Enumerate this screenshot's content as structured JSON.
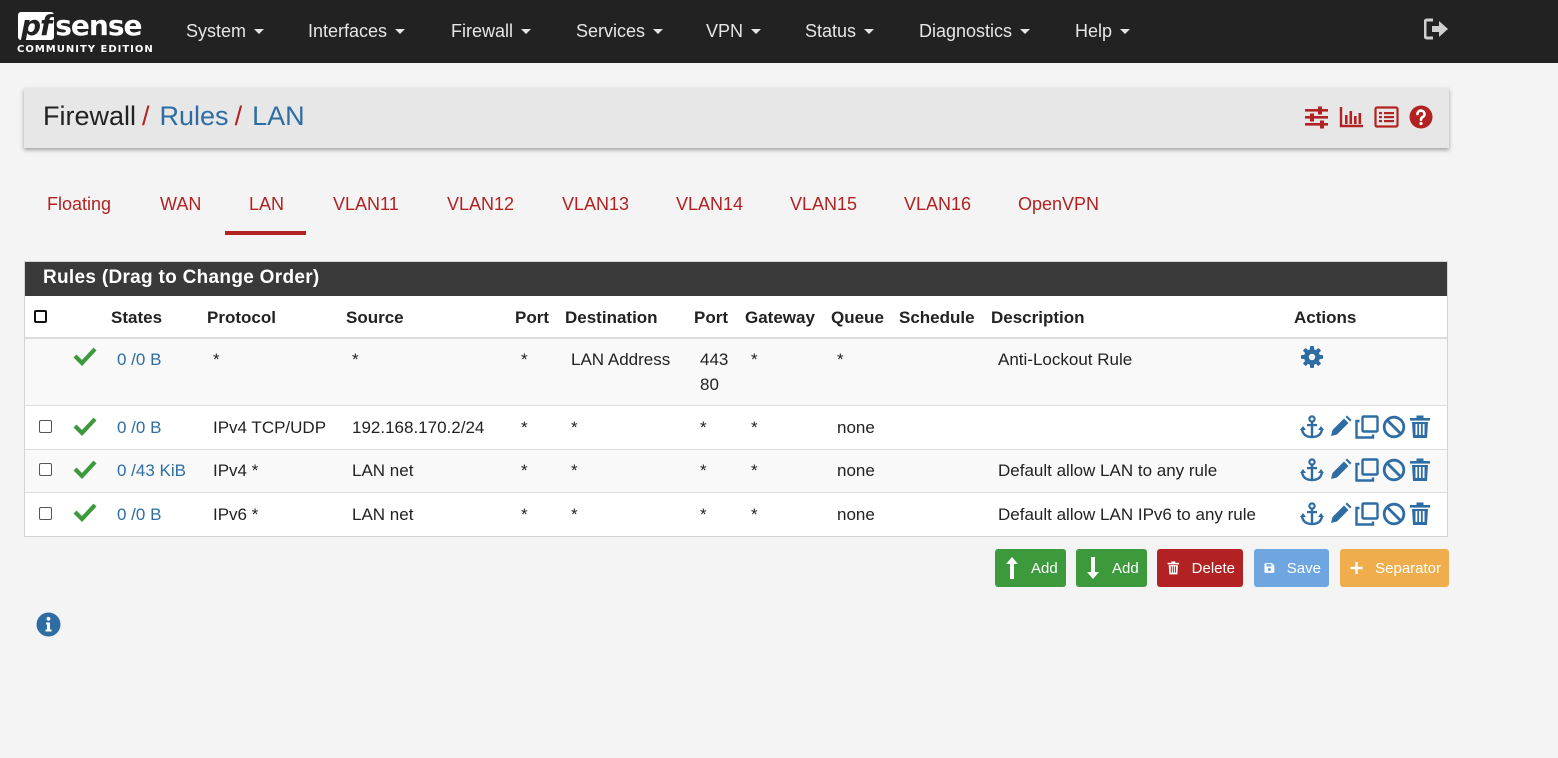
{
  "brand": {
    "logo_main_left": "pf",
    "logo_main_right": "sense",
    "logo_sub": "COMMUNITY EDITION"
  },
  "nav": {
    "menus": [
      "System",
      "Interfaces",
      "Firewall",
      "Services",
      "VPN",
      "Status",
      "Diagnostics",
      "Help"
    ],
    "logout_icon": "sign-out-icon"
  },
  "breadcrumb": {
    "root": "Firewall",
    "level2": "Rules",
    "level3": "LAN",
    "separator": "/"
  },
  "breadcrumb_icons": [
    "sliders-icon",
    "bar-chart-icon",
    "list-icon",
    "help-icon"
  ],
  "tabs": [
    "Floating",
    "WAN",
    "LAN",
    "VLAN11",
    "VLAN12",
    "VLAN13",
    "VLAN14",
    "VLAN15",
    "VLAN16",
    "OpenVPN"
  ],
  "active_tab": "LAN",
  "panel": {
    "title": "Rules (Drag to Change Order)",
    "columns": [
      "States",
      "Protocol",
      "Source",
      "Port",
      "Destination",
      "Port",
      "Gateway",
      "Queue",
      "Schedule",
      "Description",
      "Actions"
    ]
  },
  "rules": [
    {
      "states": "0 /0 B",
      "protocol": "*",
      "source": "*",
      "src_port": "*",
      "destination": "LAN Address",
      "dst_port": "443",
      "dst_port2": "80",
      "gateway": "*",
      "queue": "*",
      "schedule": "",
      "description": "Anti-Lockout Rule"
    },
    {
      "states": "0 /0 B",
      "protocol": "IPv4 TCP/UDP",
      "source": "192.168.170.2/24",
      "src_port": "*",
      "destination": "*",
      "dst_port": "*",
      "gateway": "*",
      "queue": "none",
      "schedule": "",
      "description": ""
    },
    {
      "states": "0 /43 KiB",
      "protocol": "IPv4 *",
      "source": "LAN net",
      "src_port": "*",
      "destination": "*",
      "dst_port": "*",
      "gateway": "*",
      "queue": "none",
      "schedule": "",
      "description": "Default allow LAN to any rule"
    },
    {
      "states": "0 /0 B",
      "protocol": "IPv6 *",
      "source": "LAN net",
      "src_port": "*",
      "destination": "*",
      "dst_port": "*",
      "gateway": "*",
      "queue": "none",
      "schedule": "",
      "description": "Default allow LAN IPv6 to any rule"
    }
  ],
  "buttons": {
    "add_top": "Add",
    "add_bottom": "Add",
    "delete": "Delete",
    "save": "Save",
    "separator": "Separator"
  },
  "colors": {
    "navbar": "#222222",
    "accent_red": "#b22222",
    "link_blue": "#2e6da4",
    "check_green": "#3c9a3c",
    "btn_green": "#3c9a3c",
    "btn_save": "#70a6e0",
    "btn_separator": "#f0ad4e"
  }
}
